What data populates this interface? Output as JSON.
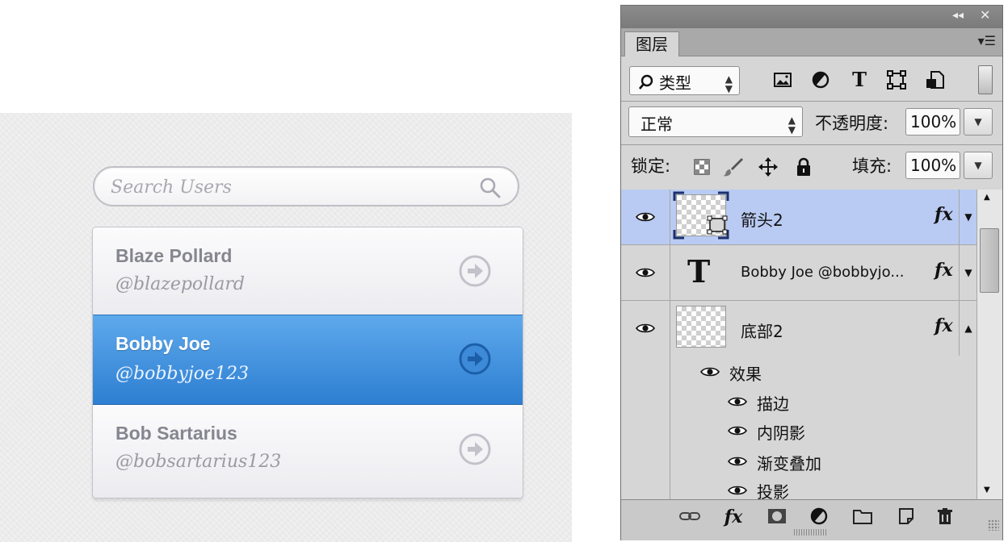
{
  "search": {
    "placeholder": "Search Users"
  },
  "users": [
    {
      "name": "Blaze Pollard",
      "handle": "@blazepollard"
    },
    {
      "name": "Bobby Joe",
      "handle": "@bobbyjoe123",
      "selected": true
    },
    {
      "name": "Bob Sartarius",
      "handle": "@bobsartarius123"
    }
  ],
  "panel": {
    "tab": "图层",
    "filter": {
      "value": "类型",
      "icons": [
        "image-filter-icon",
        "adjustment-filter-icon",
        "type-filter-icon",
        "shape-filter-icon",
        "smart-object-filter-icon"
      ]
    },
    "blend_mode": "正常",
    "opacity_label": "不透明度:",
    "opacity": "100%",
    "lock_label": "锁定:",
    "lock_icons": [
      "lock-transparent-icon",
      "lock-pixels-icon",
      "lock-position-icon",
      "lock-all-icon"
    ],
    "fill_label": "填充:",
    "fill": "100%",
    "layers": [
      {
        "name": "箭头2",
        "kind": "shape",
        "fx": "fx",
        "selected": true
      },
      {
        "name": "Bobby Joe @bobbyjo...",
        "kind": "text",
        "fx": "fx"
      },
      {
        "name": "底部2",
        "kind": "pixel",
        "fx": "fx",
        "expanded": true
      }
    ],
    "effects_header": "效果",
    "effects": [
      "描边",
      "内阴影",
      "渐变叠加",
      "投影"
    ],
    "type_glyph": "T",
    "bottom_icons": [
      "link-layers-icon",
      "fx-icon",
      "mask-icon",
      "adjustment-icon",
      "group-folder-icon",
      "new-layer-icon",
      "delete-icon"
    ],
    "fx_label": "fx"
  },
  "colors": {
    "selected_row": "#3a8ee0",
    "selected_layer": "#b9cbf2"
  }
}
